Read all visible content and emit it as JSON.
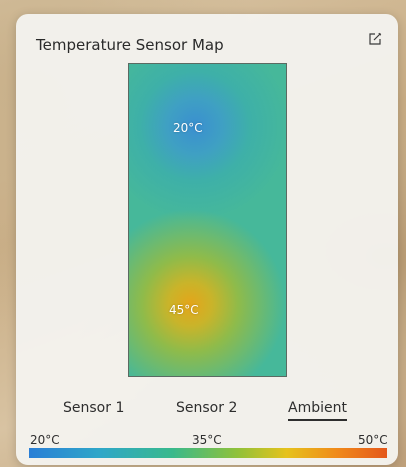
{
  "widget": {
    "title": "Temperature Sensor Map",
    "edit_icon": "edit-icon"
  },
  "heatmap": {
    "sensors": [
      {
        "label": "20°C",
        "value_c": 20
      },
      {
        "label": "45°C",
        "value_c": 45
      }
    ],
    "colors": {
      "cool": "#2a7fd6",
      "mid": "#46b89a",
      "hot": "#e4a51a",
      "border": "#5b6a62"
    }
  },
  "tabs": [
    {
      "label": "Sensor 1",
      "active": false
    },
    {
      "label": "Sensor 2",
      "active": false
    },
    {
      "label": "Ambient",
      "active": true
    }
  ],
  "scale": {
    "min_label": "20°C",
    "mid_label": "35°C",
    "max_label": "50°C"
  }
}
